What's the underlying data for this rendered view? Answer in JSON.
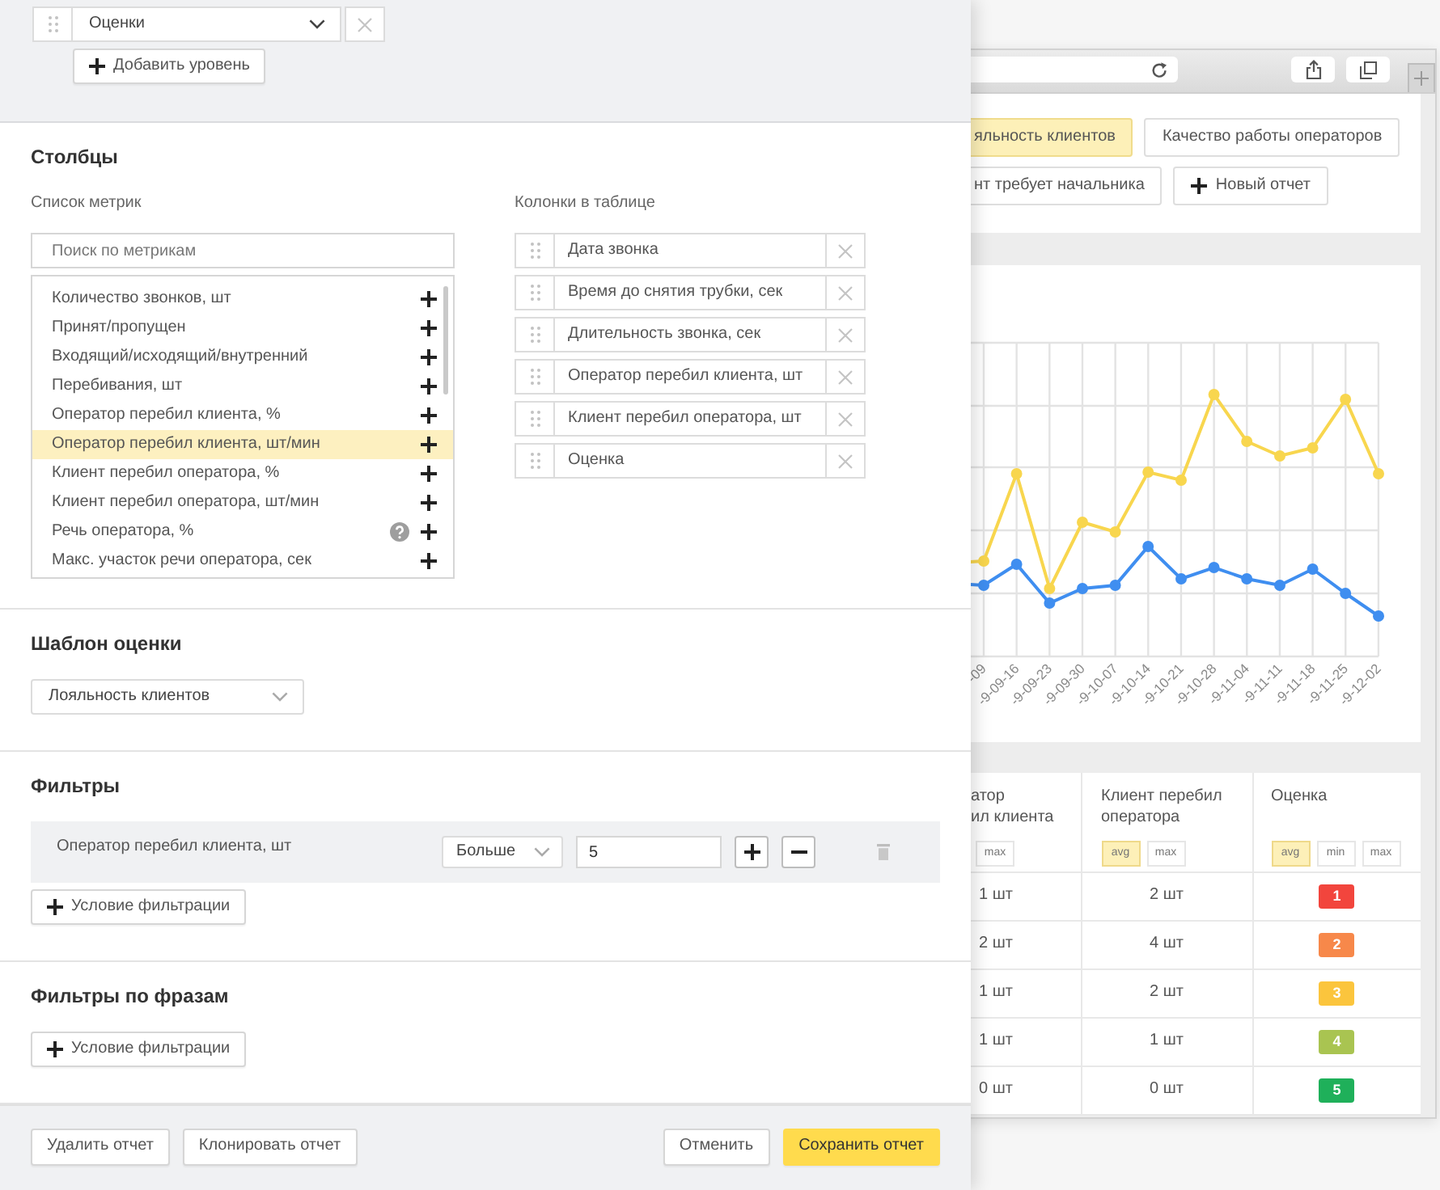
{
  "editor": {
    "grouping": {
      "levels": [
        {
          "value": "Оценки"
        }
      ],
      "add_level_button": "Добавить уровень"
    },
    "columns": {
      "title": "Столбцы",
      "metrics_label": "Список метрик",
      "search": {
        "placeholder": "Поиск по метрикам"
      },
      "metrics": [
        {
          "label": "Количество звонков, шт",
          "selected": false,
          "help": false
        },
        {
          "label": "Принят/пропущен",
          "selected": false,
          "help": false
        },
        {
          "label": "Входящий/исходящий/внутренний",
          "selected": false,
          "help": false
        },
        {
          "label": "Перебивания, шт",
          "selected": false,
          "help": false
        },
        {
          "label": "Оператор перебил клиента, %",
          "selected": false,
          "help": false
        },
        {
          "label": "Оператор перебил клиента, шт/мин",
          "selected": true,
          "help": false
        },
        {
          "label": "Клиент перебил оператора, %",
          "selected": false,
          "help": false
        },
        {
          "label": "Клиент перебил оператора, шт/мин",
          "selected": false,
          "help": false
        },
        {
          "label": "Речь оператора, %",
          "selected": false,
          "help": true
        },
        {
          "label": "Макс. участок речи оператора, сек",
          "selected": false,
          "help": false
        }
      ],
      "table_columns_label": "Колонки в таблице",
      "table_columns": [
        {
          "label": "Дата звонка"
        },
        {
          "label": "Время до снятия трубки, сек"
        },
        {
          "label": "Длительность звонка, сек"
        },
        {
          "label": "Оператор перебил клиента, шт"
        },
        {
          "label": "Клиент перебил оператора, шт"
        },
        {
          "label": "Оценка"
        }
      ]
    },
    "template": {
      "title": "Шаблон оценки",
      "value": "Лояльность клиентов"
    },
    "filters": {
      "title": "Фильтры",
      "conditions": [
        {
          "metric": "Оператор перебил клиента, шт",
          "operator": "Больше",
          "value": "5"
        }
      ],
      "add_button": "Условие фильтрации"
    },
    "phrase_filters": {
      "title": "Фильтры по фразам",
      "add_button": "Условие фильтрации"
    },
    "footer": {
      "left_buttons": [
        {
          "label": "Удалить отчет",
          "kind": "default"
        },
        {
          "label": "Клонировать отчет",
          "kind": "default"
        }
      ],
      "right_buttons": [
        {
          "label": "Отменить",
          "kind": "default"
        },
        {
          "label": "Сохранить отчет",
          "kind": "primary"
        }
      ]
    }
  },
  "browser": {
    "report_tabs": [
      {
        "label": "яльность клиентов",
        "selected": true
      },
      {
        "label": "Качество работы операторов",
        "selected": false
      },
      {
        "label": "нт требует начальника",
        "selected": false
      }
    ],
    "new_report_button": "Новый отчет",
    "chart": {
      "x_labels": [
        "-09",
        "-9-09-16",
        "-9-09-23",
        "-9-09-30",
        "-9-10-07",
        "-9-10-14",
        "-9-10-21",
        "-9-10-28",
        "-9-11-04",
        "-9-11-11",
        "-9-11-18",
        "-9-11-25",
        "-9-12-02"
      ]
    },
    "table": {
      "columns": [
        {
          "title_lines": [
            "атор",
            "ил клиента"
          ],
          "stats": [
            {
              "label": "max",
              "selected": false
            }
          ]
        },
        {
          "title_lines": [
            "Клиент перебил",
            "оператора"
          ],
          "stats": [
            {
              "label": "avg",
              "selected": true
            },
            {
              "label": "max",
              "selected": false
            }
          ]
        },
        {
          "title_lines": [
            "Оценка"
          ],
          "stats": [
            {
              "label": "avg",
              "selected": true
            },
            {
              "label": "min",
              "selected": false
            },
            {
              "label": "max",
              "selected": false
            }
          ]
        }
      ],
      "rows": [
        {
          "cells": [
            "1 шт",
            "2 шт"
          ],
          "score": "1",
          "color": "#f2453d"
        },
        {
          "cells": [
            "2 шт",
            "4 шт"
          ],
          "score": "2",
          "color": "#f7884a"
        },
        {
          "cells": [
            "1 шт",
            "2 шт"
          ],
          "score": "3",
          "color": "#fbc53d"
        },
        {
          "cells": [
            "1 шт",
            "1 шт"
          ],
          "score": "4",
          "color": "#a9c451"
        },
        {
          "cells": [
            "0 шт",
            "0 шт"
          ],
          "score": "5",
          "color": "#1fb05a"
        }
      ]
    }
  }
}
